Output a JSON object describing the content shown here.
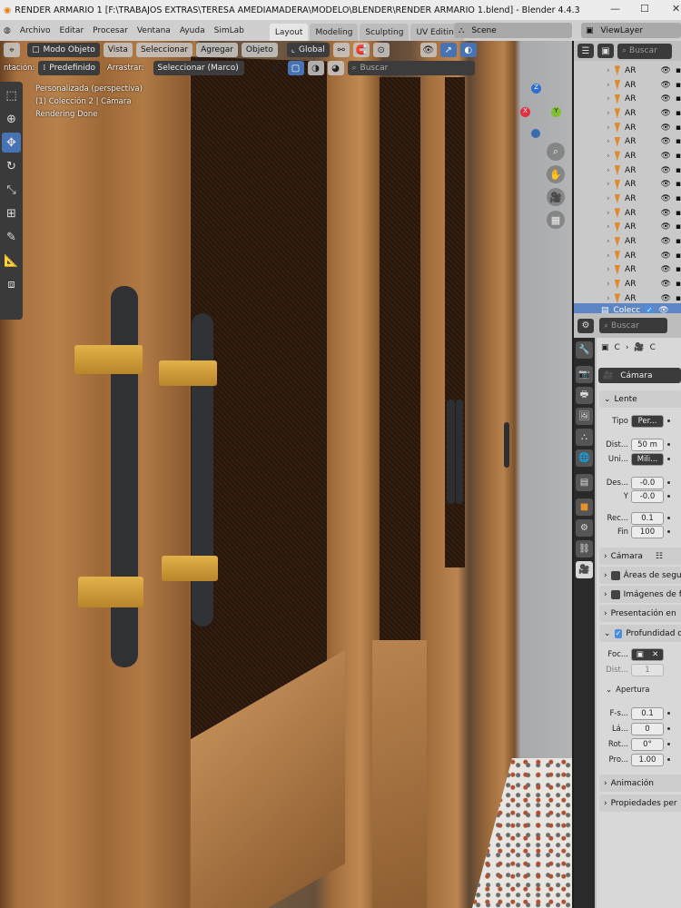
{
  "window": {
    "title": "RENDER ARMARIO 1 [F:\\TRABAJOS EXTRAS\\TERESA AMEDIAMADERA\\MODELO\\BLENDER\\RENDER ARMARIO 1.blend] - Blender 4.4.3",
    "minimize": "—",
    "maximize": "☐",
    "close": "✕"
  },
  "menu": {
    "items": [
      "Archivo",
      "Editar",
      "Procesar",
      "Ventana",
      "Ayuda",
      "SimLab"
    ],
    "workspaces": [
      "Layout",
      "Modeling",
      "Sculpting",
      "UV Editing"
    ],
    "scene": "Scene",
    "view_layer": "ViewLayer"
  },
  "viewport_header": {
    "mode": "Modo Objeto",
    "menus": [
      "Vista",
      "Seleccionar",
      "Agregar",
      "Objeto"
    ],
    "orientation_global": "Global",
    "orientation_label": "ntación:",
    "orientation_value": "Predefinido",
    "drag_label": "Arrastrar:",
    "drag_value": "Seleccionar (Marco)",
    "search_placeholder": "Buscar"
  },
  "viewport_overlay": {
    "view_name": "Personalizada (perspectiva)",
    "collection": "(1) Colección 2 | Cámara",
    "status": "Rendering Done"
  },
  "gizmo": {
    "z": "Z",
    "x": "X",
    "y": "Y"
  },
  "outliner": {
    "search_placeholder": "Buscar",
    "items": [
      "AR",
      "AR",
      "AR",
      "AR",
      "AR",
      "AR",
      "AR",
      "AR",
      "AR",
      "AR",
      "AR",
      "AR",
      "AR",
      "AR",
      "AR",
      "AR",
      "AR"
    ],
    "collection": "Colecc"
  },
  "properties": {
    "search_placeholder": "Buscar",
    "breadcrumb": [
      "C",
      "C"
    ],
    "data_name": "Cámara",
    "lens": {
      "title": "Lente",
      "type_label": "Tipo",
      "type_value": "Per...",
      "focal_label": "Dist...",
      "focal_value": "50 m",
      "units_label": "Uni...",
      "units_value": "Mili...",
      "shift_x_label": "Des...",
      "shift_x_value": "-0.0",
      "shift_y_label": "Y",
      "shift_y_value": "-0.0",
      "clip_start_label": "Rec...",
      "clip_start_value": "0.1",
      "clip_end_label": "Fin",
      "clip_end_value": "100"
    },
    "sections": [
      "Cámara",
      "Áreas de segu",
      "Imágenes de f",
      "Presentación en",
      "Profundidad d"
    ],
    "dof": {
      "focus_label": "Foc...",
      "distance_label": "Dist...",
      "distance_value": "1",
      "aperture_title": "Apertura",
      "fstop_label": "F-s...",
      "fstop_value": "0.1",
      "blades_label": "Lá...",
      "blades_value": "0",
      "rotation_label": "Rot...",
      "rotation_value": "0°",
      "ratio_label": "Pro...",
      "ratio_value": "1.00"
    },
    "bottom_sections": [
      "Animación",
      "Propiedades per"
    ]
  }
}
